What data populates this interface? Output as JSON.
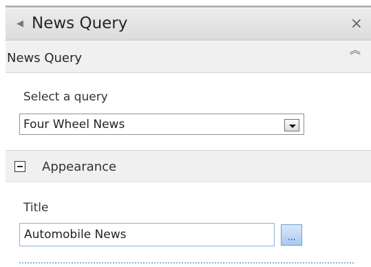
{
  "panel": {
    "title": "News Query",
    "close_glyph": "×",
    "collapse_arrow_glyph": "◀"
  },
  "section": {
    "label": "News Query",
    "collapse_glyph": "︽"
  },
  "query": {
    "label": "Select a query",
    "selected_value": "Four Wheel News"
  },
  "appearance": {
    "label": "Appearance",
    "expanded": true
  },
  "title_field": {
    "label": "Title",
    "value": "Automobile News",
    "browse_label": "..."
  },
  "icons": {
    "panel_arrow": "left-arrow-icon",
    "close": "close-icon",
    "collapse": "double-chevron-up-icon",
    "dropdown": "chevron-down-icon",
    "appearance_toggle": "minus-box-icon"
  },
  "colors": {
    "title_bar_bg": "#e2e2e2",
    "section_bg": "#f0f0f0",
    "input_border": "#8fb0d8",
    "browse_button_bg": "#bcd5f6"
  }
}
